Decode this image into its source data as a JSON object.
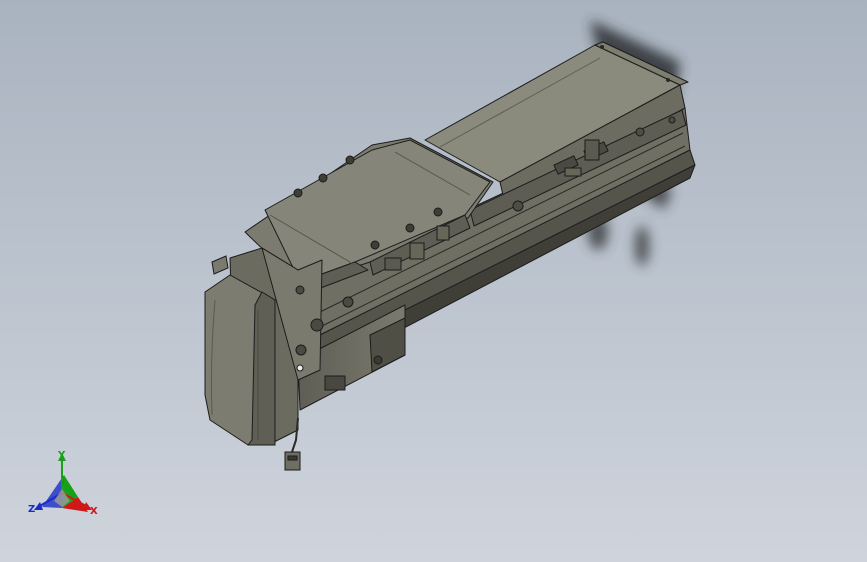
{
  "viewport": {
    "background_top": "#a9b3bf",
    "background_bottom": "#cfd4dc"
  },
  "model": {
    "body_color": "#6e6e63",
    "top_color": "#88887b",
    "dark_color": "#4a4a42",
    "edge_color": "#1c1c1c"
  },
  "triad": {
    "x_label": "X",
    "y_label": "Y",
    "z_label": "Z",
    "x_color": "#d01818",
    "y_color": "#18a018",
    "z_color": "#1a2cc8"
  }
}
